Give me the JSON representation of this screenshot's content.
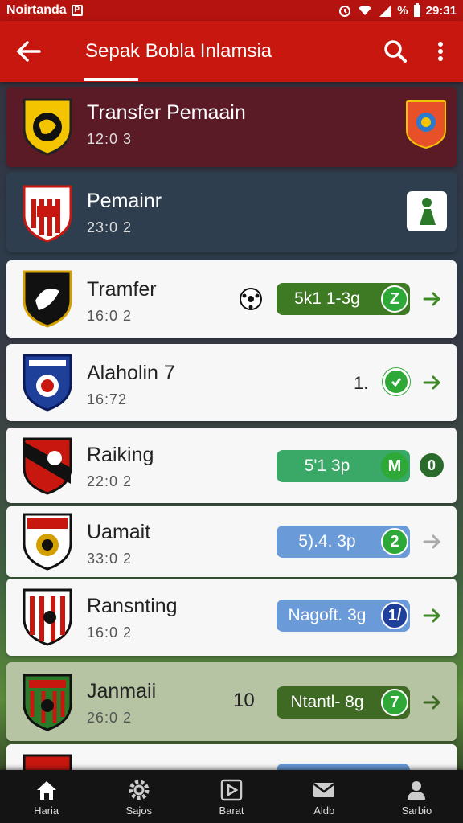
{
  "status_bar": {
    "carrier": "Noirtanda",
    "time": "29:31",
    "battery": "%"
  },
  "app_bar": {
    "title": "Sepak Bobla Inlamsia"
  },
  "items": [
    {
      "name": "Transfer Pemaain",
      "time": "12:0 3"
    },
    {
      "name": "Pemainr",
      "time": "23:0 2"
    },
    {
      "name": "Tramfer",
      "time": "16:0 2",
      "pill": "5k1 1-3g",
      "badge": "Z"
    },
    {
      "name": "Alaholin  7",
      "time": "16:72",
      "pill": "1.",
      "badge": ""
    },
    {
      "name": "Raiking",
      "time": "22:0 2",
      "pill": "5'1 3p",
      "badge": "M",
      "extra_badge": "0"
    },
    {
      "name": "Uamait",
      "time": "33:0 2",
      "pill": "5).4. 3p",
      "badge": "2"
    },
    {
      "name": "Ransnting",
      "time": "16:0 2",
      "pill": "Nagoft. 3g",
      "badge": "1/"
    },
    {
      "name": "Janmaii",
      "time": "26:0 2",
      "pill": "Ntantl- 8g",
      "badge": "7",
      "prefix": "10"
    }
  ],
  "bottom_nav": [
    {
      "label": "Haria",
      "icon": "home-icon"
    },
    {
      "label": "Sajos",
      "icon": "settings-icon"
    },
    {
      "label": "Barat",
      "icon": "play-icon"
    },
    {
      "label": "Aldb",
      "icon": "mail-icon"
    },
    {
      "label": "Sarbio",
      "icon": "profile-icon"
    }
  ]
}
